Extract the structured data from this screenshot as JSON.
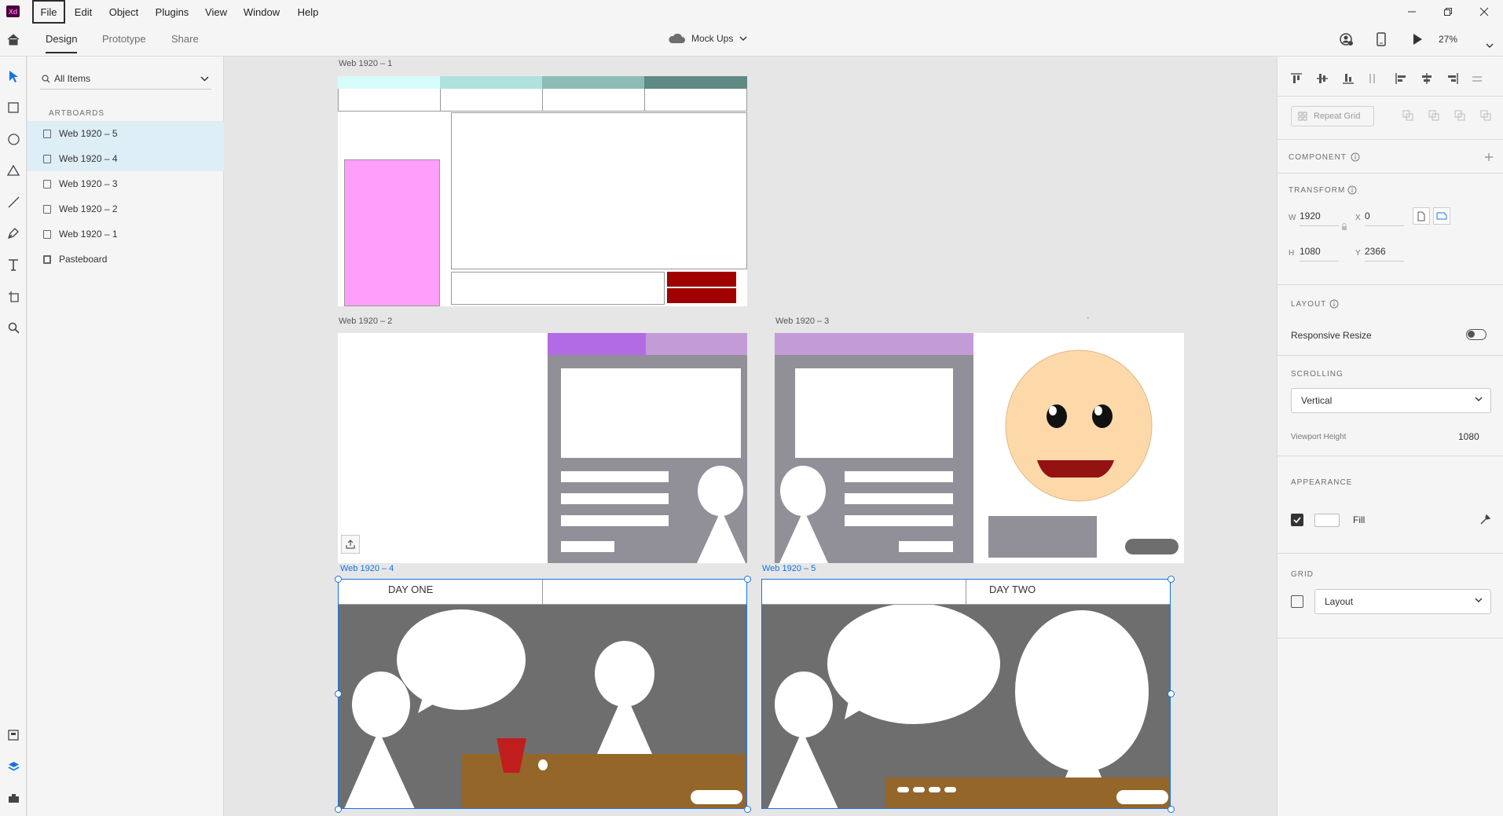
{
  "app": {
    "logo": "Xd"
  },
  "menu": [
    "File",
    "Edit",
    "Object",
    "Plugins",
    "View",
    "Window",
    "Help"
  ],
  "tabs": {
    "design": "Design",
    "prototype": "Prototype",
    "share": "Share"
  },
  "document": {
    "title": "Mock Ups",
    "zoom": "27%"
  },
  "layers": {
    "filter": "All Items",
    "section": "ARTBOARDS",
    "items": [
      "Web 1920 – 5",
      "Web 1920 – 4",
      "Web 1920 – 3",
      "Web 1920 – 2",
      "Web 1920 – 1",
      "Pasteboard"
    ]
  },
  "artboards": {
    "ab1": "Web 1920 – 1",
    "ab2": "Web 1920 – 2",
    "ab3": "Web 1920 – 3",
    "ab4": "Web 1920 – 4",
    "ab5": "Web 1920 – 5",
    "day_one": "DAY ONE",
    "day_two": "DAY TWO",
    "stray_mark": "·"
  },
  "props": {
    "repeat_grid": "Repeat Grid",
    "component": "COMPONENT",
    "transform": "TRANSFORM",
    "w_label": "W",
    "w": "1920",
    "x_label": "X",
    "x": "0",
    "h_label": "H",
    "h": "1080",
    "y_label": "Y",
    "y": "2366",
    "layout": "LAYOUT",
    "responsive": "Responsive Resize",
    "scrolling": "SCROLLING",
    "scroll_value": "Vertical",
    "viewport_label": "Viewport Height",
    "viewport": "1080",
    "appearance": "APPEARANCE",
    "fill": "Fill",
    "grid": "GRID",
    "grid_value": "Layout"
  },
  "colors": {
    "accent": "#1473e6",
    "logo_bg": "#470137",
    "pink": "#ff9ffb",
    "dark_red": "#a00000",
    "purple": "#b36be5",
    "lavender": "#c39cd7",
    "gray": "#918f97",
    "brown": "#94662a",
    "face": "#fdd9aa"
  }
}
